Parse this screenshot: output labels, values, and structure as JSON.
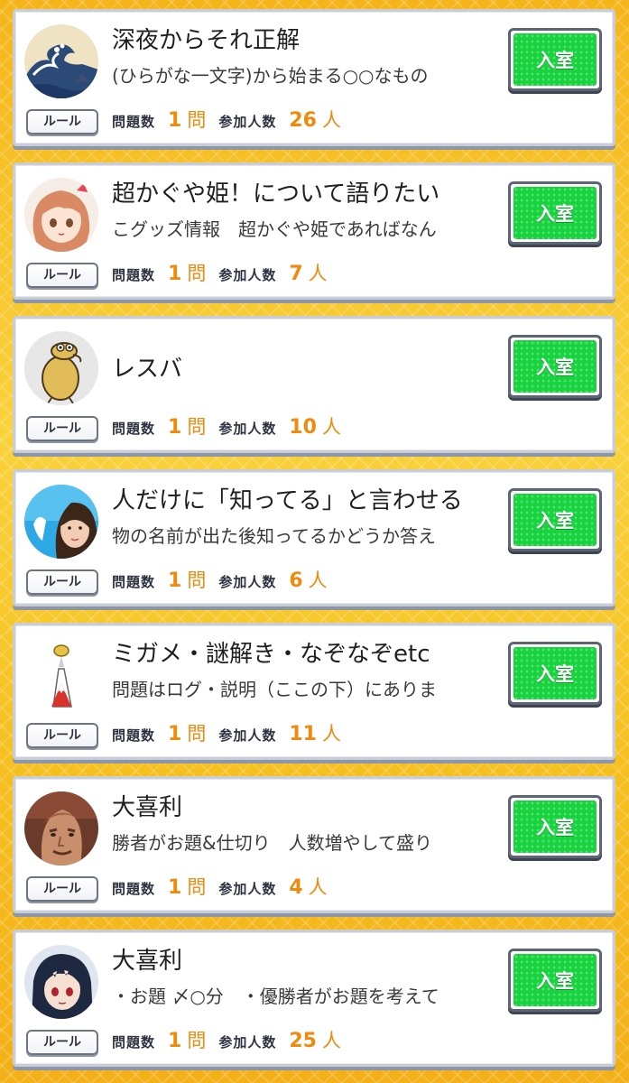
{
  "labels": {
    "rule": "ルール",
    "questions": "問題数",
    "questions_unit": "問",
    "participants": "参加人数",
    "participants_unit": "人",
    "enter": "入室"
  },
  "rooms": [
    {
      "title": "深夜からそれ正解",
      "description": "(ひらがな一文字)から始まる○○なもの",
      "question_count": "1",
      "participant_count": "26",
      "avatar_icon": "great-wave-icon"
    },
    {
      "title": "超かぐや姫！について語りたい",
      "description": "こグッズ情報　超かぐや姫であればなん",
      "question_count": "1",
      "participant_count": "7",
      "avatar_icon": "anime-girl-icon"
    },
    {
      "title": "レスバ",
      "description": "",
      "question_count": "1",
      "participant_count": "10",
      "avatar_icon": "bird-character-icon"
    },
    {
      "title": "人だけに「知ってる」と言わせる",
      "description": "物の名前が出た後知ってるかどうか答え",
      "question_count": "1",
      "participant_count": "6",
      "avatar_icon": "woman-photo-icon"
    },
    {
      "title": "ミガメ・謎解き・なぞなぞetc",
      "description": "問題はログ・説明（ここの下）にありま",
      "question_count": "1",
      "participant_count": "11",
      "avatar_icon": "mount-fuji-icon"
    },
    {
      "title": "大喜利",
      "description": "勝者がお題&仕切り　人数増やして盛り",
      "question_count": "1",
      "participant_count": "4",
      "avatar_icon": "statue-face-icon"
    },
    {
      "title": "大喜利",
      "description": "・お題 〆○分　・優勝者がお題を考えて",
      "question_count": "1",
      "participant_count": "25",
      "avatar_icon": "anime-boy-icon"
    }
  ]
}
